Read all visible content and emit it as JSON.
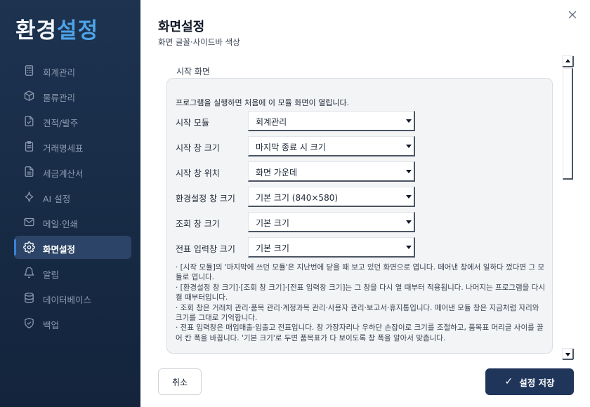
{
  "brand": {
    "part1": "환경",
    "part2": "설정"
  },
  "sidebar": {
    "items": [
      {
        "label": "회계관리",
        "icon": "calculator-icon"
      },
      {
        "label": "물류관리",
        "icon": "box-icon"
      },
      {
        "label": "견적/발주",
        "icon": "file-check-icon"
      },
      {
        "label": "거래명세표",
        "icon": "clipboard-icon"
      },
      {
        "label": "세금계산서",
        "icon": "document-icon"
      },
      {
        "label": "AI 설정",
        "icon": "sparkle-icon"
      },
      {
        "label": "메일·인쇄",
        "icon": "mail-icon"
      },
      {
        "label": "화면설정",
        "icon": "gear-icon",
        "active": true
      },
      {
        "label": "알림",
        "icon": "bell-icon"
      },
      {
        "label": "데이터베이스",
        "icon": "database-icon"
      },
      {
        "label": "백업",
        "icon": "shield-check-icon"
      }
    ]
  },
  "header": {
    "title": "화면설정",
    "subtitle": "화면 글꼴·사이드바 색상"
  },
  "section": {
    "title": "시작 화면",
    "intro": "프로그램을 실행하면 처음에 이 모듈 화면이 열립니다.",
    "rows": [
      {
        "label": "시작 모듈",
        "value": "회계관리"
      },
      {
        "label": "시작 창 크기",
        "value": "마지막 종료 시 크기"
      },
      {
        "label": "시작 창 위치",
        "value": "화면 가운데"
      },
      {
        "label": "환경설정 창 크기",
        "value": "기본 크기 (840×580)"
      },
      {
        "label": "조회 창 크기",
        "value": "기본 크기"
      },
      {
        "label": "전표 입력창 크기",
        "value": "기본 크기"
      }
    ],
    "notes": [
      "· [시작 모듈]의 '마지막에 쓰던 모듈'은 지난번에 닫을 때 보고 있던 화면으로 엽니다. 떼어낸 창에서 일하다 껐다면 그 모듈로 엽니다.",
      "· [환경설정 창 크기]·[조회 창 크기]·[전표 입력창 크기]는 그 창을 다시 열 때부터 적용됩니다. 나머지는 프로그램을 다시 켤 때부터입니다.",
      "· 조회 창은 거래처 관리·품목 관리·계정과목 관리·사용자 관리·보고서·휴지통입니다. 떼어낸 모듈 창은 지금처럼 자리와 크기를 그대로 기억합니다.",
      "· 전표 입력창은 매입매출·입출고 전표입니다. 창 가장자리나 우하단 손잡이로 크기를 조절하고, 품목표 머리글 사이를 끌어 칸 폭을 바꿉니다. '기본 크기'로 두면 품목표가 다 보이도록 창 폭을 알아서 맞춥니다."
    ]
  },
  "footer": {
    "cancel_label": "취소",
    "save_label": "설정 저장"
  },
  "colors": {
    "sidebar_bg": "#1d3350",
    "accent": "#4ea3e8",
    "save_button": "#1f355a",
    "active_item": "#2c4467"
  }
}
